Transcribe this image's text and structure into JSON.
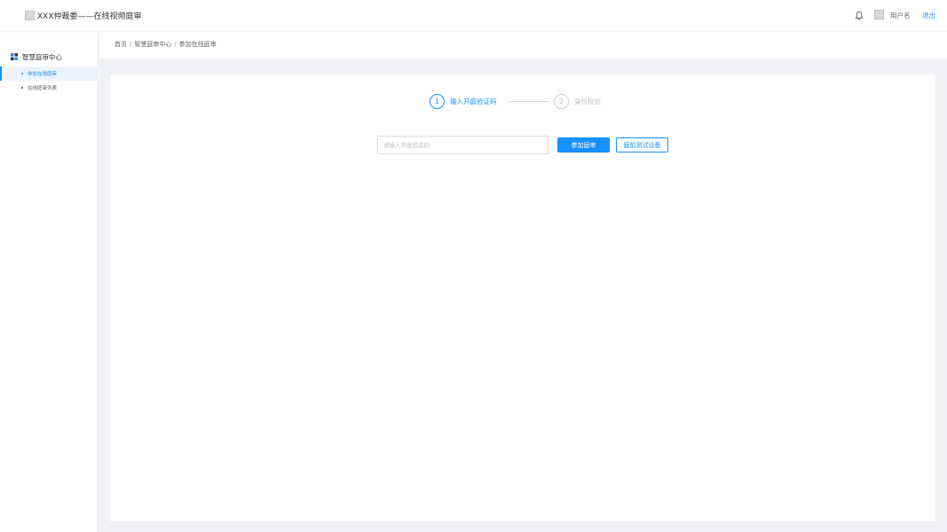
{
  "header": {
    "title": "XXX仲裁委——在线视频庭审",
    "username": "用户名",
    "logout_label": "退出",
    "icons": {
      "logo": "logo-placeholder-icon",
      "bell": "bell-icon",
      "avatar": "avatar-placeholder-icon"
    }
  },
  "sidebar": {
    "group_label": "智慧庭审中心",
    "group_icon": "grid-icon",
    "items": [
      {
        "label": "参加在线庭审",
        "active": true
      },
      {
        "label": "在线庭审列表",
        "active": false
      }
    ]
  },
  "breadcrumb": [
    "首页",
    "智慧庭审中心",
    "参加在线庭审"
  ],
  "breadcrumb_separator": "/",
  "steps": [
    {
      "number": "1",
      "label": "输入开庭验证码",
      "active": true
    },
    {
      "number": "2",
      "label": "身份校验",
      "active": false
    }
  ],
  "form": {
    "code_placeholder": "请输入开庭验证码",
    "code_value": "",
    "join_label": "参加庭审",
    "test_label": "庭前测试设备"
  },
  "colors": {
    "accent": "#1890ff",
    "content_background": "#f0f2f5",
    "sidebar_active_background": "#eef3fb",
    "inactive": "#bfbfbf"
  }
}
